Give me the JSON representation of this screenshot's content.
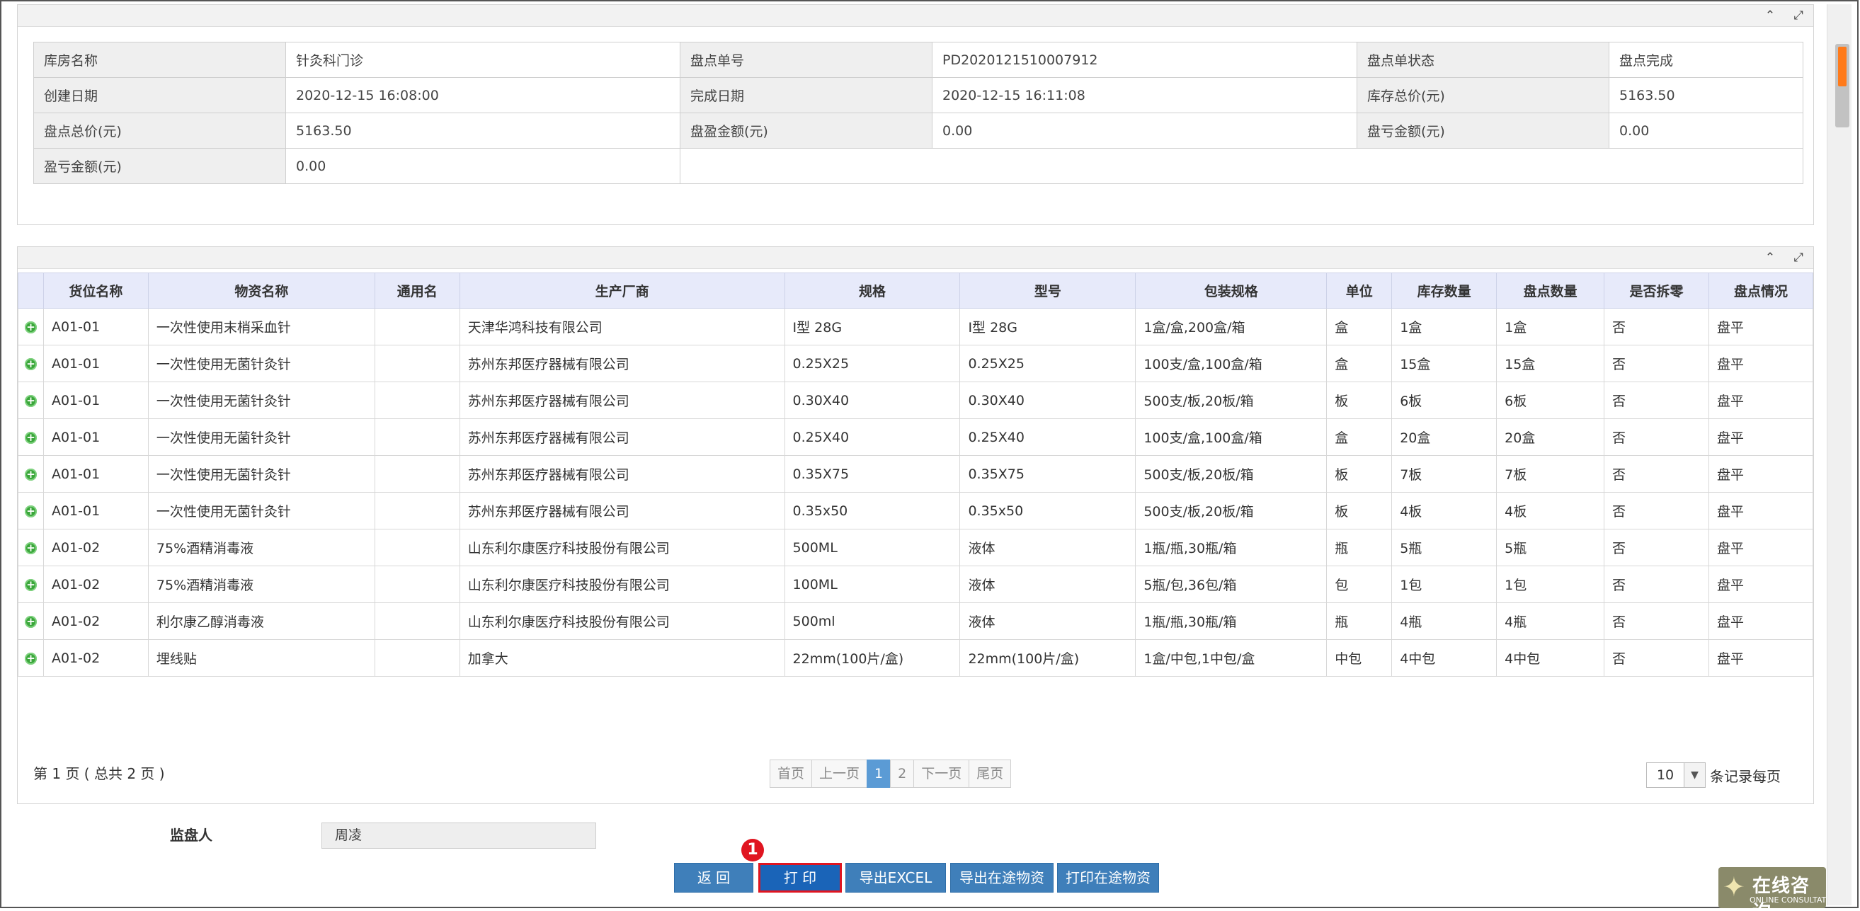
{
  "info": {
    "rows": [
      [
        {
          "label": "库房名称",
          "value": "针灸科门诊"
        },
        {
          "label": "盘点单号",
          "value": "PD2020121510007912"
        },
        {
          "label": "盘点单状态",
          "value": "盘点完成"
        }
      ],
      [
        {
          "label": "创建日期",
          "value": "2020-12-15 16:08:00"
        },
        {
          "label": "完成日期",
          "value": "2020-12-15 16:11:08"
        },
        {
          "label": "库存总价(元)",
          "value": "5163.50"
        }
      ],
      [
        {
          "label": "盘点总价(元)",
          "value": "5163.50"
        },
        {
          "label": "盘盈金额(元)",
          "value": "0.00"
        },
        {
          "label": "盘亏金额(元)",
          "value": "0.00"
        }
      ]
    ],
    "last_row": {
      "label": "盈亏金额(元)",
      "value": "0.00"
    }
  },
  "panel_tools": {
    "collapse": "⌃",
    "expand": "⤢"
  },
  "grid": {
    "headers": [
      "货位名称",
      "物资名称",
      "通用名",
      "生产厂商",
      "规格",
      "型号",
      "包装规格",
      "单位",
      "库存数量",
      "盘点数量",
      "是否拆零",
      "盘点情况"
    ],
    "rows": [
      [
        "A01-01",
        "一次性使用末梢采血针",
        "",
        "天津华鸿科技有限公司",
        "I型 28G",
        "I型 28G",
        "1盒/盒,200盒/箱",
        "盒",
        "1盒",
        "1盒",
        "否",
        "盘平"
      ],
      [
        "A01-01",
        "一次性使用无菌针灸针",
        "",
        "苏州东邦医疗器械有限公司",
        "0.25X25",
        "0.25X25",
        "100支/盒,100盒/箱",
        "盒",
        "15盒",
        "15盒",
        "否",
        "盘平"
      ],
      [
        "A01-01",
        "一次性使用无菌针灸针",
        "",
        "苏州东邦医疗器械有限公司",
        "0.30X40",
        "0.30X40",
        "500支/板,20板/箱",
        "板",
        "6板",
        "6板",
        "否",
        "盘平"
      ],
      [
        "A01-01",
        "一次性使用无菌针灸针",
        "",
        "苏州东邦医疗器械有限公司",
        "0.25X40",
        "0.25X40",
        "100支/盒,100盒/箱",
        "盒",
        "20盒",
        "20盒",
        "否",
        "盘平"
      ],
      [
        "A01-01",
        "一次性使用无菌针灸针",
        "",
        "苏州东邦医疗器械有限公司",
        "0.35X75",
        "0.35X75",
        "500支/板,20板/箱",
        "板",
        "7板",
        "7板",
        "否",
        "盘平"
      ],
      [
        "A01-01",
        "一次性使用无菌针灸针",
        "",
        "苏州东邦医疗器械有限公司",
        "0.35x50",
        "0.35x50",
        "500支/板,20板/箱",
        "板",
        "4板",
        "4板",
        "否",
        "盘平"
      ],
      [
        "A01-02",
        "75%酒精消毒液",
        "",
        "山东利尔康医疗科技股份有限公司",
        "500ML",
        "液体",
        "1瓶/瓶,30瓶/箱",
        "瓶",
        "5瓶",
        "5瓶",
        "否",
        "盘平"
      ],
      [
        "A01-02",
        "75%酒精消毒液",
        "",
        "山东利尔康医疗科技股份有限公司",
        "100ML",
        "液体",
        "5瓶/包,36包/箱",
        "包",
        "1包",
        "1包",
        "否",
        "盘平"
      ],
      [
        "A01-02",
        "利尔康乙醇消毒液",
        "",
        "山东利尔康医疗科技股份有限公司",
        "500ml",
        "液体",
        "1瓶/瓶,30瓶/箱",
        "瓶",
        "4瓶",
        "4瓶",
        "否",
        "盘平"
      ],
      [
        "A01-02",
        "埋线贴",
        "",
        "加拿大",
        "22mm(100片/盒)",
        "22mm(100片/盒)",
        "1盒/中包,1中包/盒",
        "中包",
        "4中包",
        "4中包",
        "否",
        "盘平"
      ]
    ]
  },
  "pager": {
    "info": "第 1 页 ( 总共 2 页 )",
    "first": "首页",
    "prev": "上一页",
    "pages": [
      "1",
      "2"
    ],
    "next": "下一页",
    "last": "尾页",
    "page_size": "10",
    "page_size_label": "条记录每页"
  },
  "supervisor": {
    "label": "监盘人",
    "value": "周凌"
  },
  "buttons": {
    "back": "返 回",
    "print": "打 印",
    "export_excel": "导出EXCEL",
    "export_transit": "导出在途物资",
    "print_transit": "打印在途物资"
  },
  "badge": "1",
  "consult": {
    "title": "在线咨询",
    "subtitle": "ONLINE CONSULTATION"
  }
}
